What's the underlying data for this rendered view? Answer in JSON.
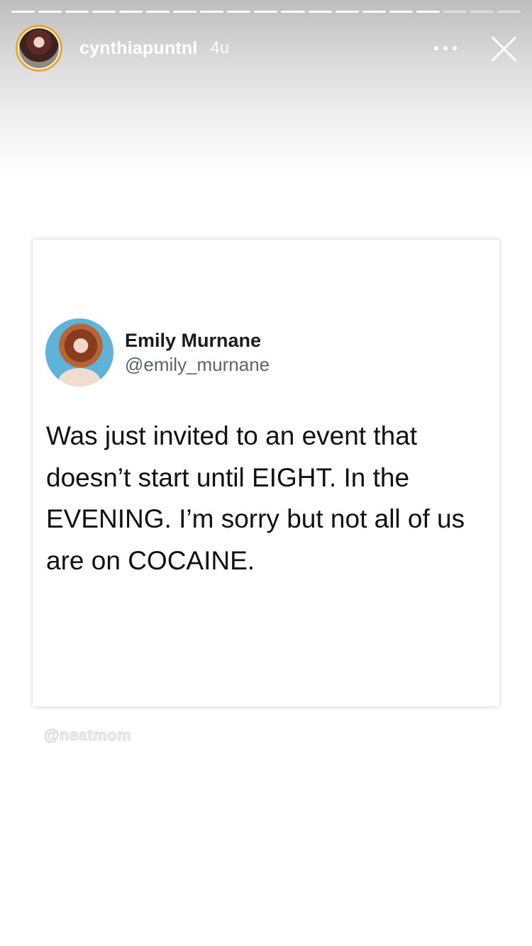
{
  "progress": {
    "segments_total": 19,
    "current_segment": 16
  },
  "header": {
    "username": "cynthiapuntnl",
    "time": "4u",
    "more_icon": "more-horizontal-icon",
    "close_icon": "close-icon"
  },
  "tweet": {
    "author_name": "Emily Murnane",
    "author_handle": "@emily_murnane",
    "text_lines": [
      "Was just invited to an event that",
      "doesn’t start until EIGHT. In the",
      "EVENING. I’m sorry but not all of us",
      "are on COCAINE."
    ]
  },
  "watermark": "@neatmom",
  "colors": {
    "avatar_ring": "#e9a82b",
    "header_text": "#ffffff"
  }
}
